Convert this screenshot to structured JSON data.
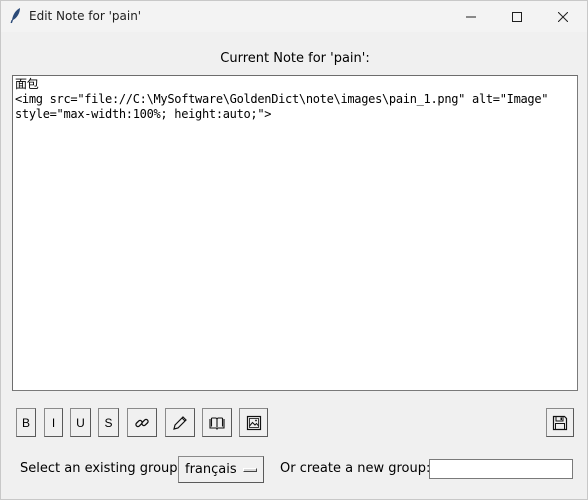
{
  "window": {
    "title": "Edit Note for 'pain'"
  },
  "heading": "Current Note for 'pain':",
  "note_lines": [
    "面包",
    "<img src=\"file://C:\\MySoftware\\GoldenDict\\note\\images\\pain_1.png\" alt=\"Image\"",
    "style=\"max-width:100%; height:auto;\">"
  ],
  "toolbar": {
    "bold_label": "B",
    "italic_label": "I",
    "underline_label": "U",
    "strike_label": "S",
    "link_icon": "link-icon",
    "pen_icon": "pen-icon",
    "book_icon": "book-icon",
    "image_icon": "image-icon",
    "save_icon": "save-icon"
  },
  "footer": {
    "existing_group_label": "Select an existing group:",
    "existing_group_value": "français",
    "new_group_label": "Or create a new group:",
    "new_group_value": ""
  },
  "colors": {
    "window_bg": "#f0f0f0",
    "editor_bg": "#ffffff",
    "border": "#7a7a7a"
  }
}
